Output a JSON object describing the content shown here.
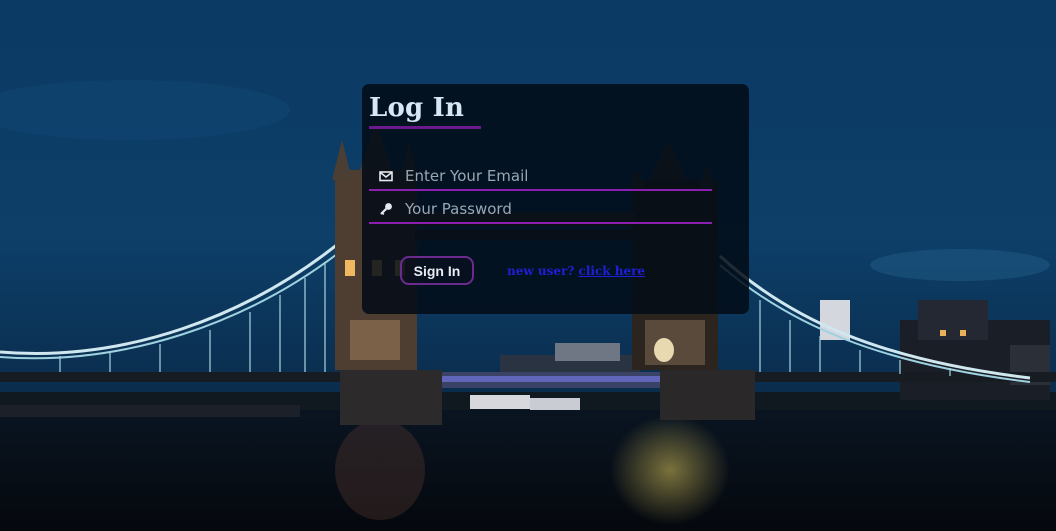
{
  "login": {
    "title": "Log In",
    "email_placeholder": "Enter Your Email",
    "password_placeholder": "Your Password",
    "signin_label": "Sign In",
    "new_user_text": "new user?",
    "click_here_label": "click here",
    "email_icon": "envelope-icon",
    "password_icon": "key-icon"
  },
  "colors": {
    "accent": "#8b1fb0",
    "title": "#d7e7f3",
    "link": "#1f1fd6",
    "card_bg": "#020c16"
  },
  "background": {
    "subject": "tower-bridge-at-night"
  }
}
